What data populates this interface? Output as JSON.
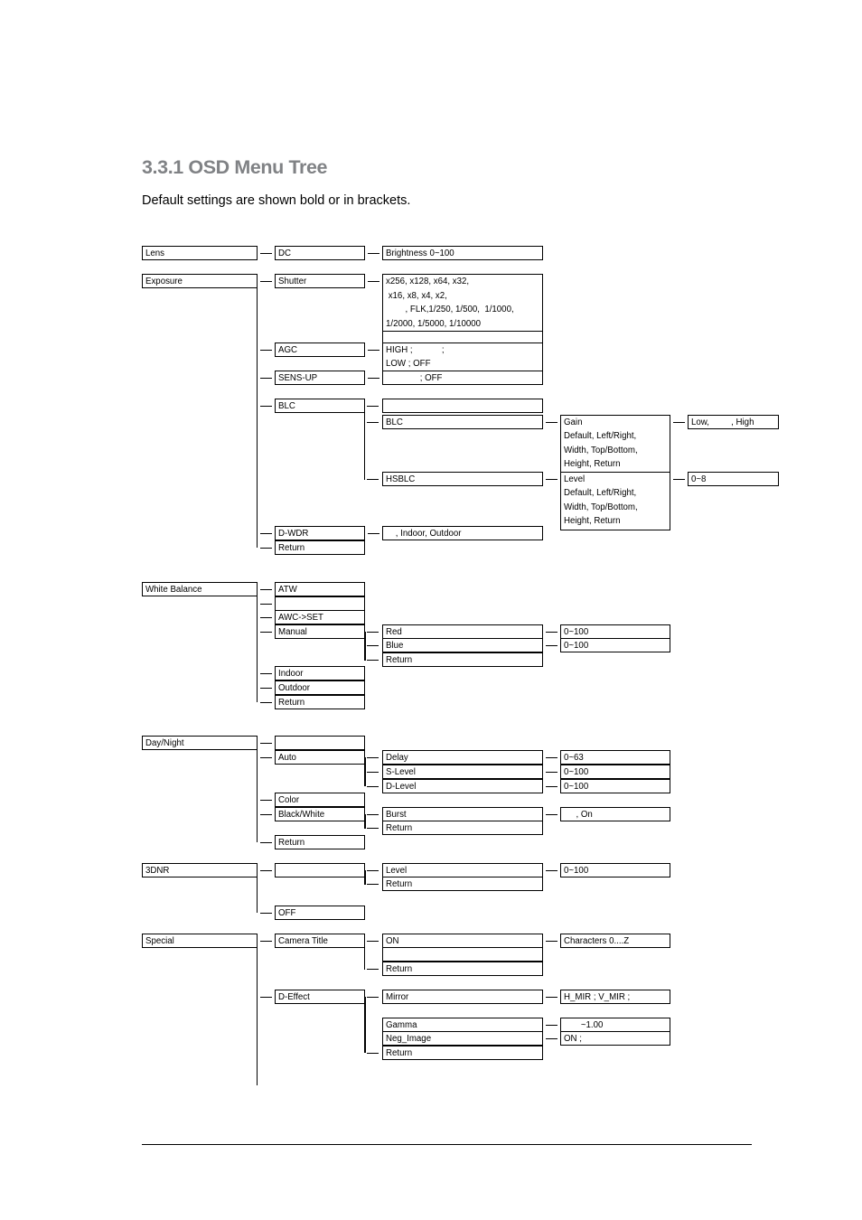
{
  "page": {
    "heading": "3.3.1 OSD Menu Tree",
    "subtitle": "Default settings are shown bold or in brackets."
  },
  "tree": {
    "lens": {
      "root": "Lens",
      "dc": "DC",
      "brightness": "Brightness 0~100"
    },
    "exposure": {
      "root": "Exposure",
      "shutter": "Shutter",
      "shutter_values": "x256, x128, x64, x32,\n x16, x8, x4, x2,\n        , FLK,1/250, 1/500,  1/1000,\n1/2000, 1/5000, 1/10000",
      "shutter_blank": "",
      "agc": "AGC",
      "agc_values": "HIGH ;            ;\nLOW ; OFF",
      "sens_up": "SENS-UP",
      "sens_up_values": "              ; OFF",
      "blc": "BLC",
      "blc_blank": "",
      "blc_sub": "BLC",
      "hsblc": "HSBLC",
      "gain": "Gain\nDefault, Left/Right,\nWidth, Top/Bottom,\nHeight, Return",
      "gain_values": "Low,         , High",
      "level": "Level\nDefault, Left/Right,\nWidth, Top/Bottom,\nHeight, Return",
      "level_values": "0~8",
      "d_wdr": "D-WDR",
      "d_wdr_values": "    , Indoor, Outdoor",
      "return": "Return"
    },
    "white_balance": {
      "root": "White Balance",
      "atw": "ATW",
      "blank": "",
      "awc_set": "AWC->SET",
      "manual": "Manual",
      "red": "Red",
      "red_values": "0~100",
      "blue": "Blue",
      "blue_values": "0~100",
      "manual_return": "Return",
      "indoor": "Indoor",
      "outdoor": "Outdoor",
      "return": "Return"
    },
    "day_night": {
      "root": "Day/Night",
      "blank": "",
      "auto": "Auto",
      "delay": "Delay",
      "delay_values": "0~63",
      "s_level": "S-Level",
      "s_level_values": "0~100",
      "d_level": "D-Level",
      "d_level_values": "0~100",
      "color": "Color",
      "black_white": "Black/White",
      "burst": "Burst",
      "burst_values": "     , On",
      "bw_return": "Return",
      "return": "Return"
    },
    "threednr": {
      "root": "3DNR",
      "blank": "",
      "level": "Level",
      "level_values": "0~100",
      "return": "Return",
      "off": "OFF"
    },
    "special": {
      "root": "Special",
      "camera_title": "Camera Title",
      "on": "ON",
      "characters": "Characters 0....Z",
      "title_blank": "",
      "title_return": "Return",
      "d_effect": "D-Effect",
      "mirror": "Mirror",
      "mirror_values": "H_MIR ; V_MIR ;",
      "gamma": "Gamma",
      "gamma_values": "       ~1.00",
      "neg_image": "Neg_Image",
      "neg_image_values": "ON ;",
      "effect_return": "Return"
    }
  }
}
